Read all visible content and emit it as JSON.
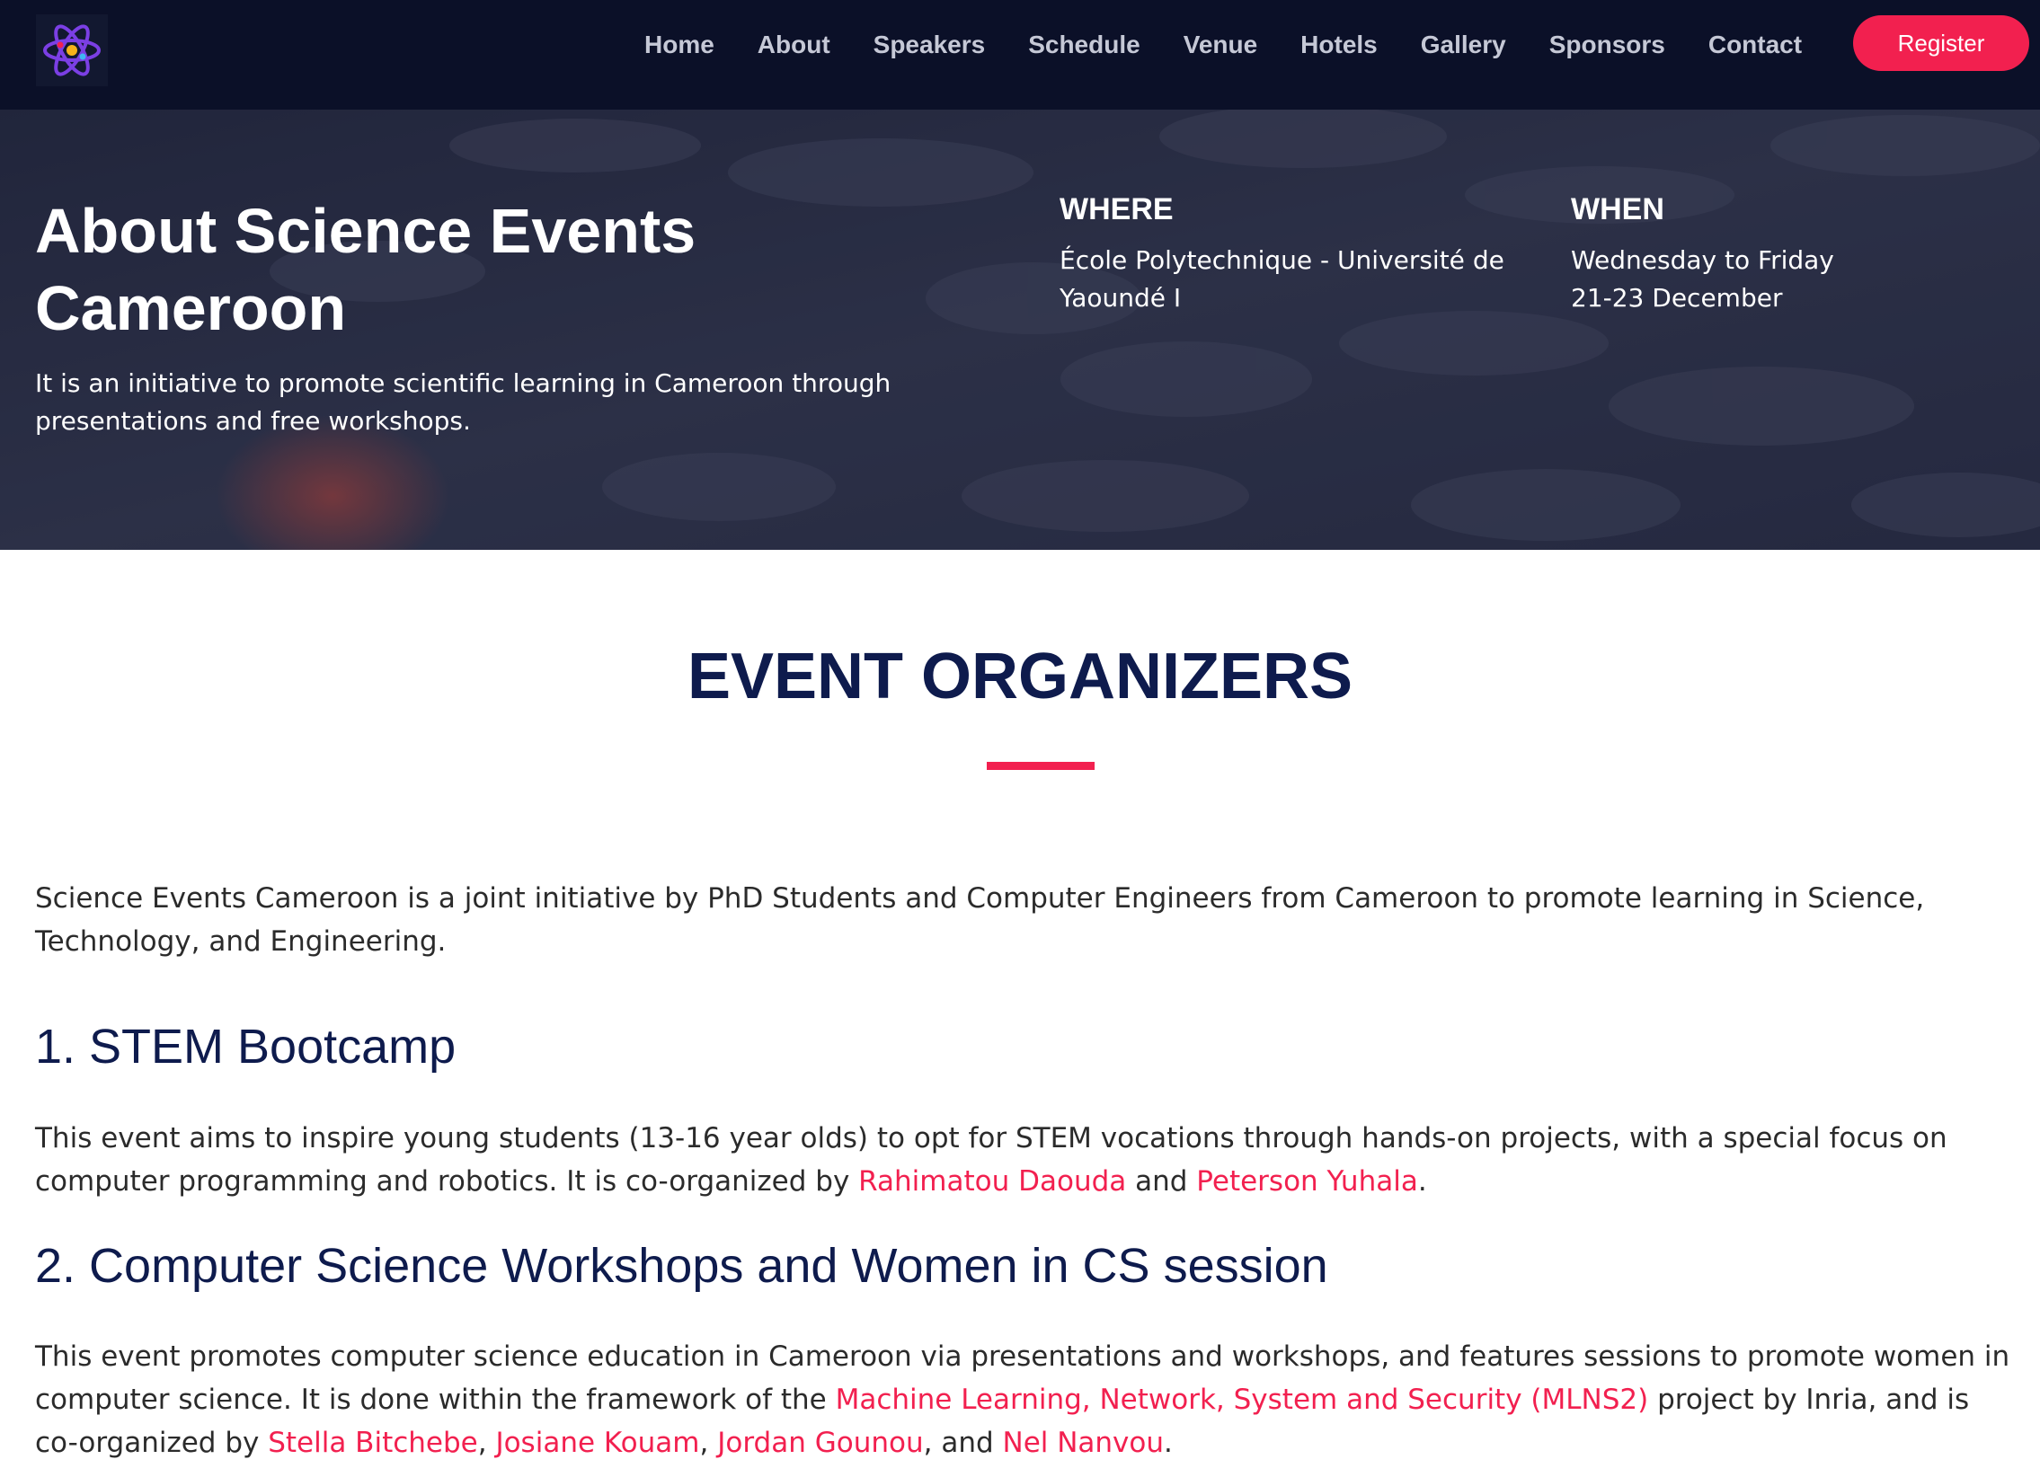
{
  "nav": {
    "items": [
      "Home",
      "About",
      "Speakers",
      "Schedule",
      "Venue",
      "Hotels",
      "Gallery",
      "Sponsors",
      "Contact"
    ],
    "register_label": "Register"
  },
  "hero": {
    "title": "About Science Events Cameroon",
    "subtitle": "It is an initiative to promote scientific learning in Cameroon through presentations and free workshops.",
    "where_heading": "WHERE",
    "where_text": "École Polytechnique - Université de Yaoundé I",
    "when_heading": "WHEN",
    "when_line1": "Wednesday to Friday",
    "when_line2": "21-23 December"
  },
  "section": {
    "title": "EVENT ORGANIZERS",
    "intro": "Science Events Cameroon is a joint initiative by PhD Students and Computer Engineers from Cameroon to promote learning in Science, Technology, and Engineering."
  },
  "stem": {
    "heading": "1. STEM Bootcamp",
    "text_before": "This event aims to inspire young students (13-16 year olds) to opt for STEM vocations through hands-on projects, with a special focus on computer programming and robotics. It is co-organized by ",
    "person1": "Rahimatou Daouda",
    "and": " and ",
    "person2": "Peterson Yuhala",
    "end": "."
  },
  "cs": {
    "heading": "2. Computer Science Workshops and Women in CS session",
    "text_before": "This event promotes computer science education in Cameroon via presentations and workshops, and features sessions to promote women in computer science. It is done within the framework of the ",
    "project_link": "Machine Learning, Network, System and Security (MLNS2)",
    "text_mid": " project by Inria, and is co-organized by ",
    "person1": "Stella Bitchebe",
    "sep1": ", ",
    "person2": "Josiane Kouam",
    "sep2": ", ",
    "person3": "Jordan Gounou",
    "sep3": ", and ",
    "person4": "Nel Nanvou",
    "end": "."
  },
  "colors": {
    "nav_bg": "#0b1028",
    "accent": "#f2204f",
    "heading": "#0e1b4d"
  }
}
